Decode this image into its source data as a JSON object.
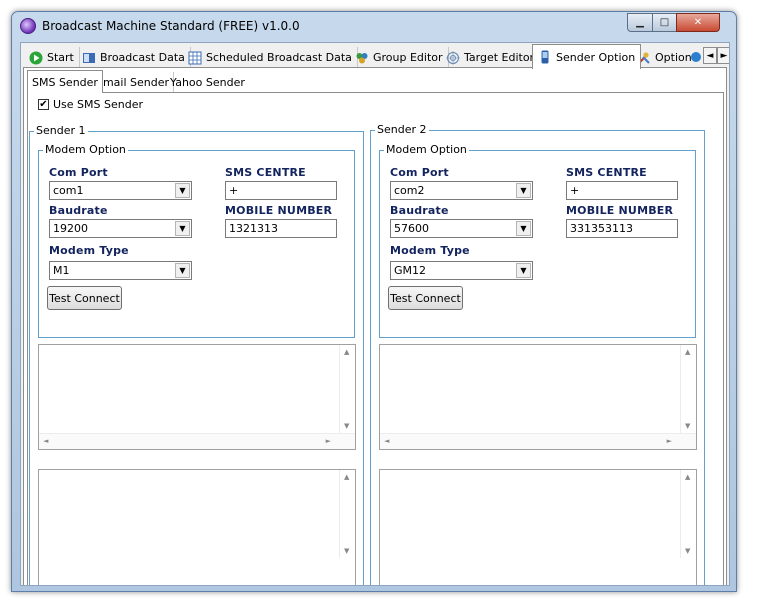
{
  "window": {
    "title": "Broadcast Machine Standard (FREE) v1.0.0",
    "controls": {
      "minimize": "▁",
      "maximize": "□",
      "close": "✕"
    }
  },
  "main_tabs": [
    {
      "label": "Start",
      "icon": "play-icon"
    },
    {
      "label": "Broadcast Data",
      "icon": "database-icon"
    },
    {
      "label": "Scheduled Broadcast Data",
      "icon": "grid-icon"
    },
    {
      "label": "Group Editor",
      "icon": "group-icon"
    },
    {
      "label": "Target Editor",
      "icon": "target-icon"
    },
    {
      "label": "Sender Option",
      "icon": "phone-icon",
      "active": true
    },
    {
      "label": "Option",
      "icon": "tools-icon"
    }
  ],
  "tab_scroll": {
    "left": "◄",
    "right": "►"
  },
  "sub_tabs": [
    {
      "label": "SMS Sender",
      "active": true
    },
    {
      "label": "Email Sender"
    },
    {
      "label": "Yahoo Sender"
    }
  ],
  "use_sms_sender": {
    "label": "Use SMS Sender",
    "checked": true,
    "mark": "✔"
  },
  "senders": [
    {
      "title": "Sender 1",
      "modem_group": "Modem Option",
      "com_port_label": "Com Port",
      "com_port": "com1",
      "baudrate_label": "Baudrate",
      "baudrate": "19200",
      "modem_type_label": "Modem Type",
      "modem_type": "M1",
      "sms_centre_label": "SMS CENTRE",
      "sms_centre": "+",
      "mobile_label": "MOBILE NUMBER",
      "mobile": "1321313",
      "test_button": "Test Connect"
    },
    {
      "title": "Sender 2",
      "modem_group": "Modem Option",
      "com_port_label": "Com Port",
      "com_port": "com2",
      "baudrate_label": "Baudrate",
      "baudrate": "57600",
      "modem_type_label": "Modem Type",
      "modem_type": "GM12",
      "sms_centre_label": "SMS CENTRE",
      "sms_centre": "+",
      "mobile_label": "MOBILE NUMBER",
      "mobile": "331353113",
      "test_button": "Test Connect"
    }
  ],
  "glyphs": {
    "dropdown": "▼",
    "up": "▲",
    "down": "▼",
    "left": "◄",
    "right": "►"
  },
  "colors": {
    "accent_label": "#12235e",
    "group_border": "#64a0cc",
    "close": "#c84a33"
  }
}
